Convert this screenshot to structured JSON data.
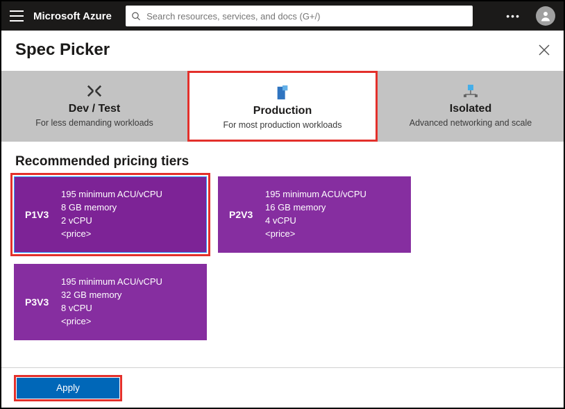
{
  "header": {
    "brand": "Microsoft Azure",
    "search_placeholder": "Search resources, services, and docs (G+/)"
  },
  "blade": {
    "title": "Spec Picker"
  },
  "tabs": [
    {
      "name": "Dev / Test",
      "desc": "For less demanding workloads"
    },
    {
      "name": "Production",
      "desc": "For most production workloads"
    },
    {
      "name": "Isolated",
      "desc": "Advanced networking and scale"
    }
  ],
  "section_title": "Recommended pricing tiers",
  "tiers": [
    {
      "sku": "P1V3",
      "acu": "195 minimum ACU/vCPU",
      "mem": "8 GB memory",
      "cpu": "2 vCPU",
      "price": "<price>"
    },
    {
      "sku": "P2V3",
      "acu": "195 minimum ACU/vCPU",
      "mem": "16 GB memory",
      "cpu": "4 vCPU",
      "price": "<price>"
    },
    {
      "sku": "P3V3",
      "acu": "195 minimum ACU/vCPU",
      "mem": "32 GB memory",
      "cpu": "8 vCPU",
      "price": "<price>"
    }
  ],
  "footer": {
    "apply_label": "Apply"
  }
}
